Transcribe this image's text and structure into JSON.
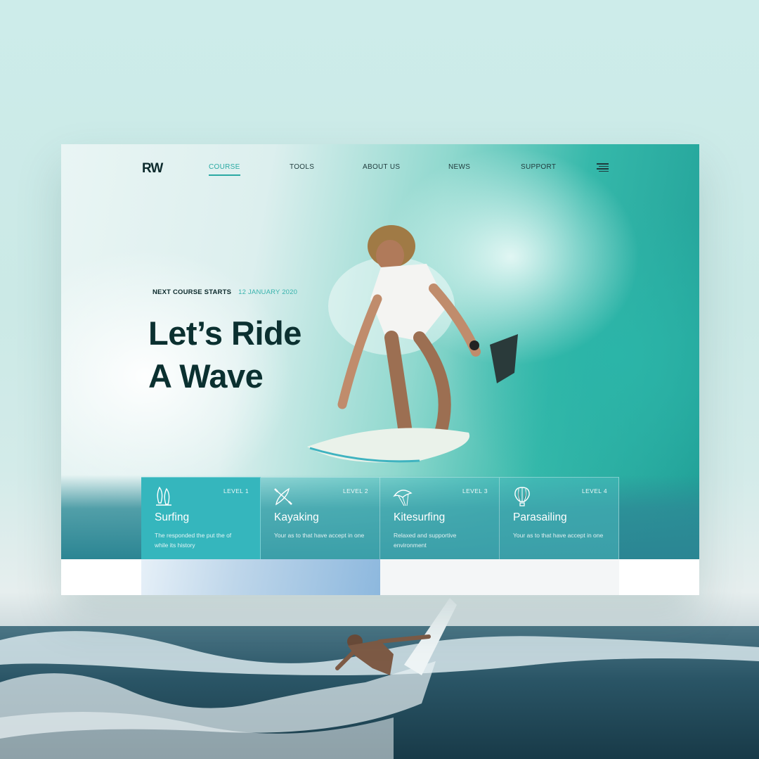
{
  "brand": {
    "logo_text": "RW"
  },
  "nav": {
    "items": [
      {
        "label": "COURSE",
        "active": true
      },
      {
        "label": "TOOLS",
        "active": false
      },
      {
        "label": "ABOUT US",
        "active": false
      },
      {
        "label": "NEWS",
        "active": false
      },
      {
        "label": "SUPPORT",
        "active": false
      }
    ],
    "menu_icon": "hamburger-menu-icon"
  },
  "hero": {
    "next_course_label": "NEXT COURSE STARTS",
    "next_course_date": "12 JANUARY 2020",
    "headline_line1": "Let’s Ride",
    "headline_line2": "A Wave"
  },
  "levels": [
    {
      "level": "LEVEL 1",
      "title": "Surfing",
      "description": "The responded the put the of while its history",
      "icon": "surfboard-icon",
      "active": true
    },
    {
      "level": "LEVEL 2",
      "title": "Kayaking",
      "description": "Your as to that have accept in one",
      "icon": "kayak-icon",
      "active": false
    },
    {
      "level": "LEVEL 3",
      "title": "Kitesurfing",
      "description": "Relaxed and supportive environment",
      "icon": "kite-icon",
      "active": false
    },
    {
      "level": "LEVEL 4",
      "title": "Parasailing",
      "description": "Your as to that have accept in one",
      "icon": "hot-air-balloon-icon",
      "active": false
    }
  ],
  "colors": {
    "accent": "#2aa9a3",
    "headline": "#0b3030",
    "card_active": "#35b6bd",
    "background": "#cdecea"
  }
}
